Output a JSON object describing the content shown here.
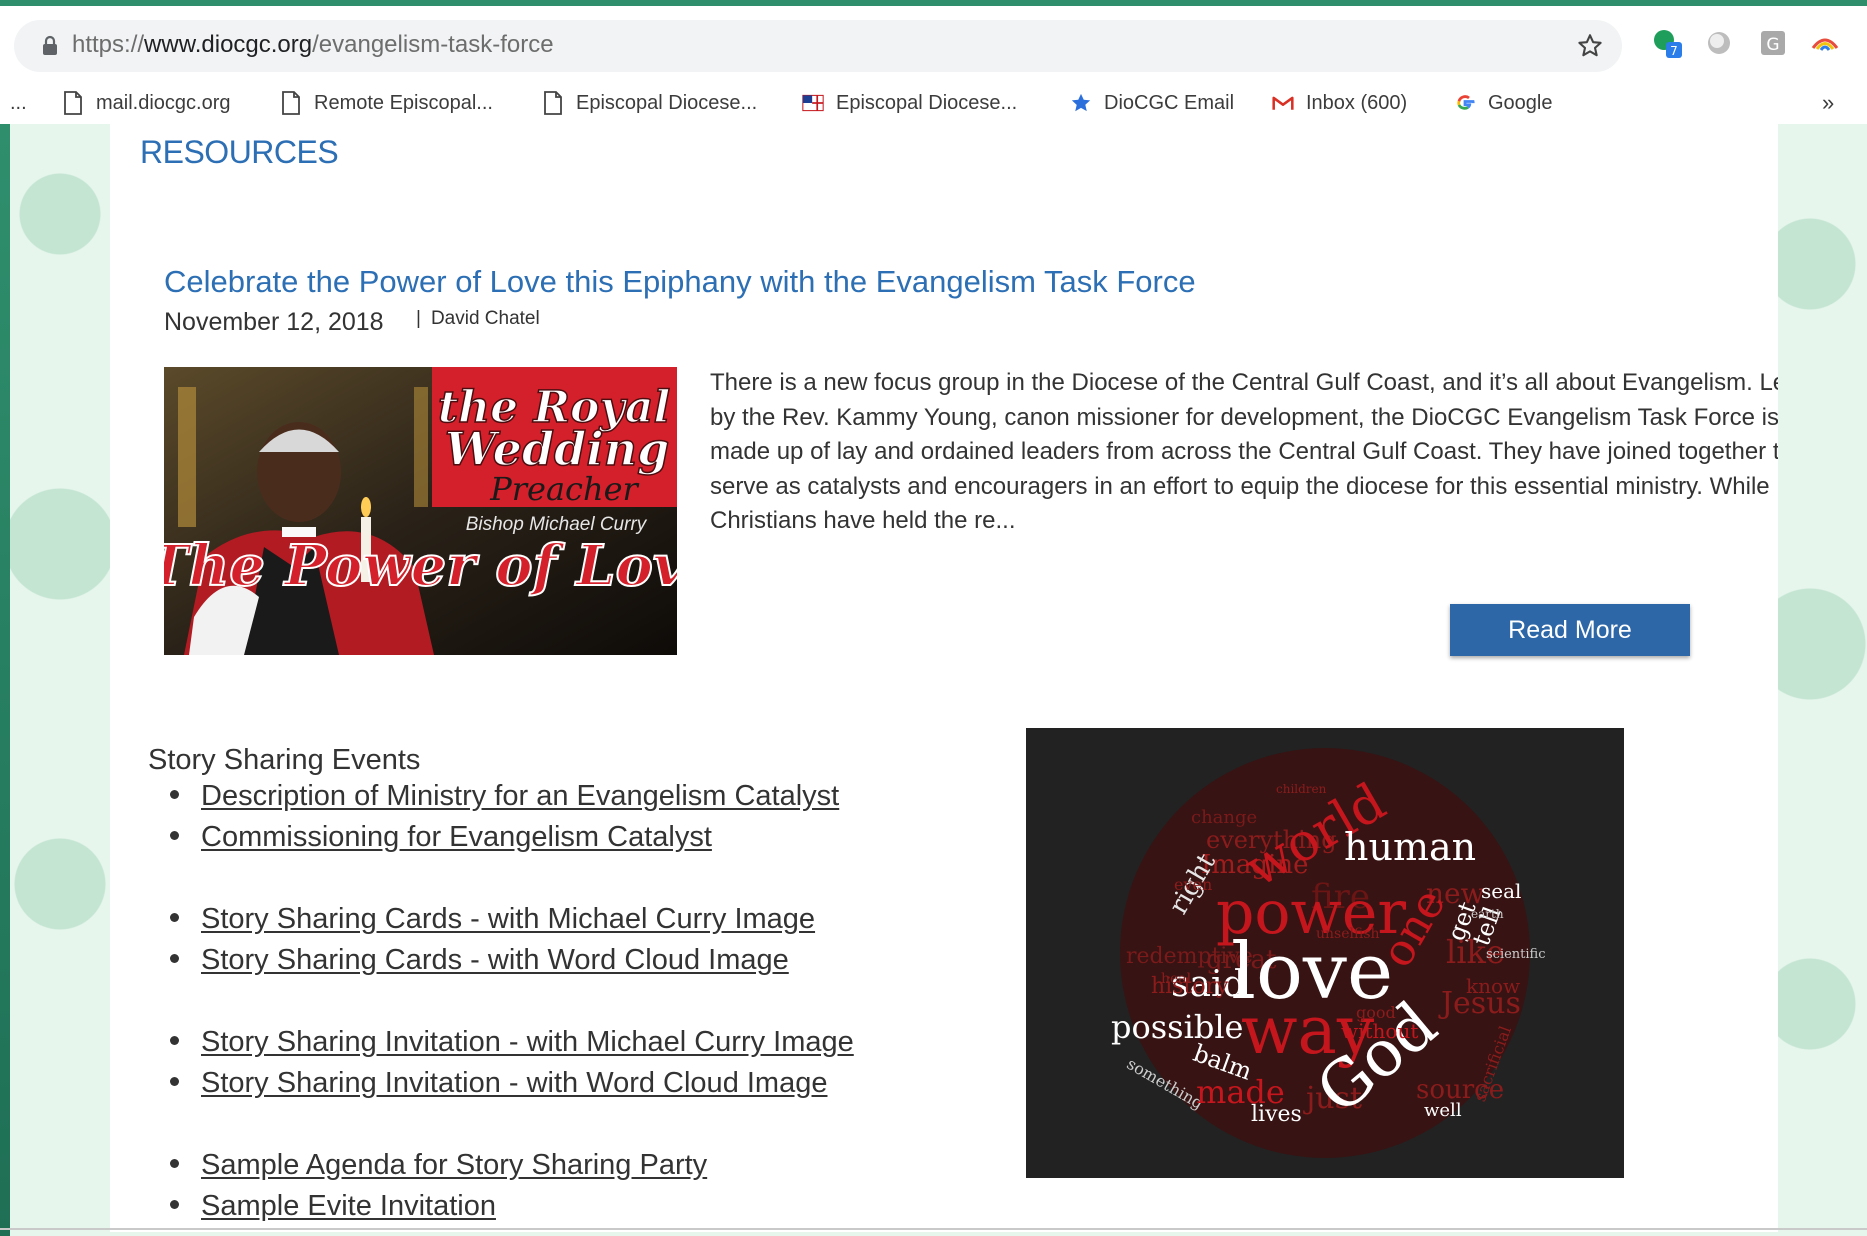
{
  "browser": {
    "url_prefix": "https://",
    "url_domain": "www.diocgc.org",
    "url_path": "/evangelism-task-force",
    "extension_badge": "7",
    "extension_letter": "G",
    "bookmarks": {
      "edge": "...",
      "items": [
        {
          "label": "mail.diocgc.org",
          "icon": "page-icon"
        },
        {
          "label": "Remote Episcopal...",
          "icon": "page-icon"
        },
        {
          "label": "Episcopal Diocese...",
          "icon": "page-icon"
        },
        {
          "label": "Episcopal Diocese...",
          "icon": "flag-icon"
        },
        {
          "label": "DioCGC Email",
          "icon": "star-icon"
        },
        {
          "label": "Inbox (600)",
          "icon": "gmail-icon"
        },
        {
          "label": "Google",
          "icon": "google-icon"
        }
      ],
      "more": "»"
    }
  },
  "page": {
    "heading": "RESOURCES",
    "post": {
      "title": "Celebrate the Power of Love this Epiphany with the Evangelism Task Force",
      "date": "November 12, 2018",
      "author_sep": "|",
      "author": "David Chatel",
      "image": {
        "line1": "the Royal",
        "line2": "Wedding",
        "line3": "Preacher",
        "line4": "Bishop Michael Curry",
        "line5": "The Power of Love"
      },
      "excerpt": "There is a new focus group in the Diocese of the Central Gulf Coast, and it’s all about Evangelism. Led by the Rev. Kammy Young, canon missioner for development, the DioCGC Evangelism Task Force is made up of lay and ordained leaders from across the Central Gulf Coast. They have joined together to serve as catalysts and encouragers in an effort to equip the diocese for this essential ministry. While Christians have held the re...",
      "read_more": "Read More"
    },
    "section_title": "Story Sharing Events",
    "links": [
      "Description of Ministry for an Evangelism Catalyst",
      "Commissioning for Evangelism Catalyst",
      "Story Sharing Cards - with Michael Curry Image",
      "Story Sharing Cards - with Word Cloud Image",
      "Story Sharing Invitation - with Michael Curry Image",
      "Story Sharing Invitation - with Word Cloud Image",
      "Sample Agenda for Story Sharing Party",
      "Sample Evite Invitation"
    ],
    "word_cloud": {
      "words": [
        "love",
        "way",
        "God",
        "power",
        "world",
        "human",
        "said",
        "possible",
        "made",
        "Jesus",
        "one",
        "like",
        "new",
        "seal",
        "right",
        "get",
        "tell",
        "balm",
        "lives",
        "history",
        "great",
        "good",
        "Imagine",
        "everything",
        "change",
        "fire",
        "know",
        "redemptive",
        "without",
        "just",
        "well",
        "source",
        "something",
        "scientific",
        "sacrificial",
        "unselfish",
        "even",
        "heal",
        "earth",
        "children"
      ]
    }
  },
  "colors": {
    "link_blue": "#2d6fb4",
    "button_blue": "#2e67a7",
    "page_bg": "#e6f6ec",
    "red": "#c4161c"
  }
}
